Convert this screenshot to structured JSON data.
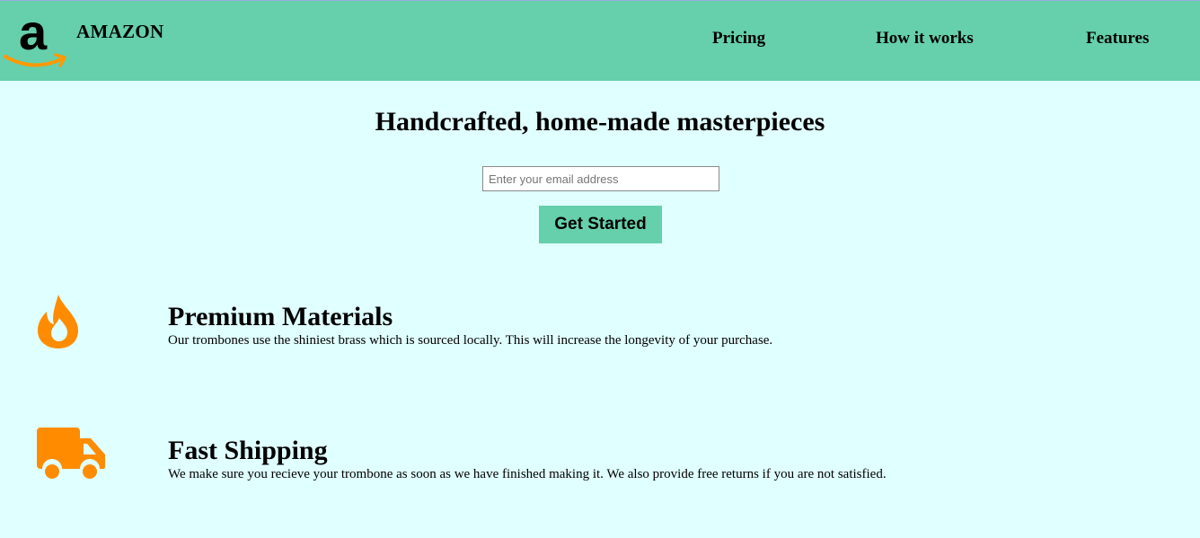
{
  "header": {
    "brand": "AMAZON",
    "logo_icon": "amazon-logo",
    "nav": [
      {
        "label": "Pricing"
      },
      {
        "label": "How it works"
      },
      {
        "label": "Features"
      }
    ]
  },
  "hero": {
    "title": "Handcrafted, home-made masterpieces",
    "email_placeholder": "Enter your email address",
    "email_value": "",
    "button_label": "Get Started"
  },
  "features": [
    {
      "icon": "fire-icon",
      "title": "Premium Materials",
      "description": "Our trombones use the shiniest brass which is sourced locally. This will increase the longevity of your purchase."
    },
    {
      "icon": "truck-icon",
      "title": "Fast Shipping",
      "description": "We make sure you recieve your trombone as soon as we have finished making it. We also provide free returns if you are not satisfied."
    }
  ],
  "colors": {
    "header_background": "#66cfac",
    "page_background": "#e0ffff",
    "icon_accent": "#ff8c00",
    "logo_smile": "#ff9900"
  }
}
